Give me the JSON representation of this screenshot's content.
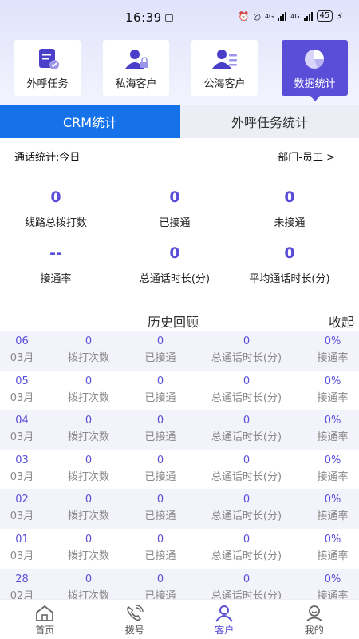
{
  "status_bar": {
    "time": "16:39",
    "network_1": "4G",
    "network_2": "4G",
    "battery": "45"
  },
  "quick_tabs": [
    {
      "label": "外呼任务",
      "icon": "task-doc-icon",
      "active": false
    },
    {
      "label": "私海客户",
      "icon": "private-customer-icon",
      "active": false
    },
    {
      "label": "公海客户",
      "icon": "public-customer-icon",
      "active": false
    },
    {
      "label": "数据统计",
      "icon": "pie-chart-icon",
      "active": true
    }
  ],
  "segments": {
    "left": "CRM统计",
    "right": "外呼任务统计",
    "active": "left"
  },
  "call_stats": {
    "label": "通话统计:今日",
    "filter": "部门-员工 >"
  },
  "metrics": [
    {
      "value": "0",
      "label": "线路总拨打数"
    },
    {
      "value": "0",
      "label": "已接通"
    },
    {
      "value": "0",
      "label": "未接通"
    },
    {
      "value": "--",
      "label": "接通率"
    },
    {
      "value": "0",
      "label": "总通话时长(分)"
    },
    {
      "value": "0",
      "label": "平均通话时长(分)"
    }
  ],
  "history": {
    "title": "历史回顾",
    "collapse": "收起",
    "columns": [
      "拨打次数",
      "已接通",
      "总通话时长(分)",
      "接通率"
    ],
    "rows": [
      {
        "day": "06",
        "month": "03月",
        "calls": "0",
        "connected": "0",
        "duration": "0",
        "rate": "0%"
      },
      {
        "day": "05",
        "month": "03月",
        "calls": "0",
        "connected": "0",
        "duration": "0",
        "rate": "0%"
      },
      {
        "day": "04",
        "month": "03月",
        "calls": "0",
        "connected": "0",
        "duration": "0",
        "rate": "0%"
      },
      {
        "day": "03",
        "month": "03月",
        "calls": "0",
        "connected": "0",
        "duration": "0",
        "rate": "0%"
      },
      {
        "day": "02",
        "month": "03月",
        "calls": "0",
        "connected": "0",
        "duration": "0",
        "rate": "0%"
      },
      {
        "day": "01",
        "month": "03月",
        "calls": "0",
        "connected": "0",
        "duration": "0",
        "rate": "0%"
      },
      {
        "day": "28",
        "month": "02月",
        "calls": "0",
        "connected": "0",
        "duration": "0",
        "rate": "0%"
      }
    ]
  },
  "bottom_nav": [
    {
      "label": "首页",
      "icon": "home-icon",
      "active": false
    },
    {
      "label": "拨号",
      "icon": "phone-dial-icon",
      "active": false
    },
    {
      "label": "客户",
      "icon": "customer-icon",
      "active": true
    },
    {
      "label": "我的",
      "icon": "profile-icon",
      "active": false
    }
  ],
  "colors": {
    "accent": "#5a4ed9",
    "segment_active": "#1672e8",
    "row_alt": "#f3f3fb"
  }
}
